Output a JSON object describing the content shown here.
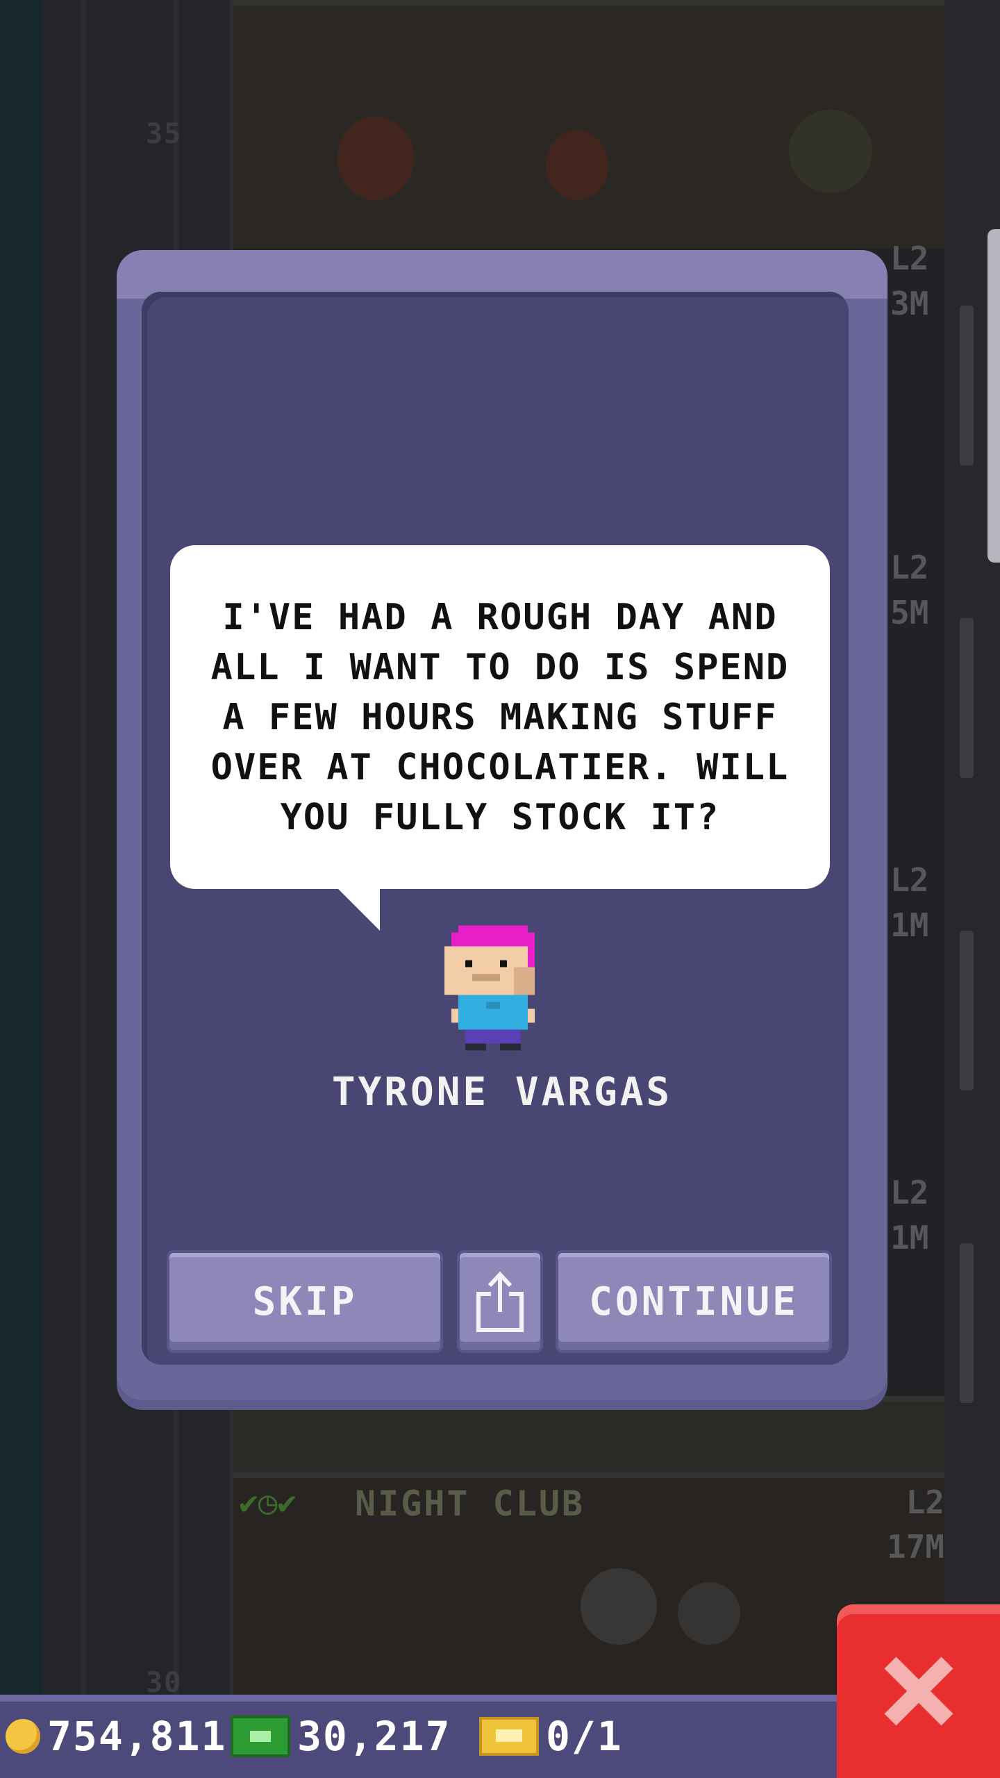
{
  "background": {
    "floor_numbers": [
      "35",
      "30"
    ],
    "right_labels": [
      "L2",
      "3M",
      "L2",
      "5M",
      "L2",
      "1M",
      "L2",
      "1M"
    ],
    "floor_in_view": {
      "name": "NIGHT CLUB",
      "level": "L2",
      "population": "17M"
    }
  },
  "dialog": {
    "message": "I'VE HAD A ROUGH DAY AND ALL I WANT TO DO IS SPEND A FEW HOURS MAKING STUFF OVER AT CHOCOLATIER. WILL YOU FULLY STOCK IT?",
    "character_name": "TYRONE VARGAS",
    "character_hair_color": "#e81fc8",
    "buttons": {
      "skip": "SKIP",
      "share_icon": "share-icon",
      "continue": "CONTINUE"
    }
  },
  "close_button": {
    "icon": "close-icon",
    "color": "#e82e2e"
  },
  "status_bar": {
    "coins": "754,811",
    "bux": "30,217",
    "tickets": "0/1"
  },
  "colors": {
    "modal_frame": "#6b6699",
    "modal_inner": "#4a4673",
    "button": "#8d88b8",
    "status_bar": "#4d497a"
  }
}
